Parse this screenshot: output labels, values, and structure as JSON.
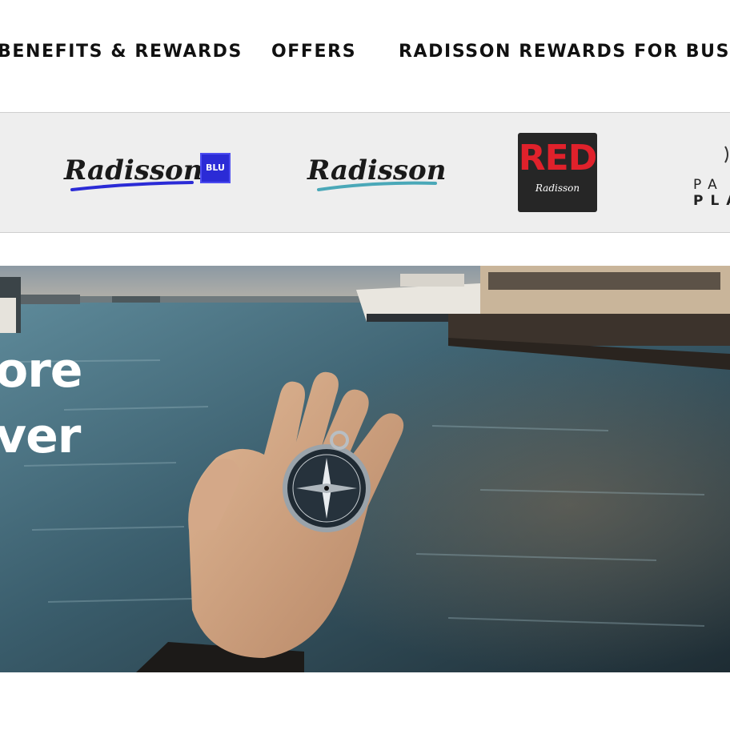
{
  "nav": {
    "items": [
      "BENEFITS & REWARDS",
      "OFFERS",
      "RADISSON REWARDS FOR BUSINESS"
    ]
  },
  "brands": {
    "blu": {
      "name": "Radisson",
      "badge": "BLU"
    },
    "radisson": {
      "name": "Radisson"
    },
    "red": {
      "word": "RED",
      "sub": "Radisson"
    },
    "park_plaza": {
      "line1": "PA",
      "line2": "PLA"
    }
  },
  "hero": {
    "headline_lines": [
      "ore",
      "ver"
    ]
  },
  "colors": {
    "nav_text": "#111111",
    "brand_strip_bg": "#eeeeee",
    "blu_badge": "#2b2bd6",
    "red_brand": "#e0212b"
  }
}
